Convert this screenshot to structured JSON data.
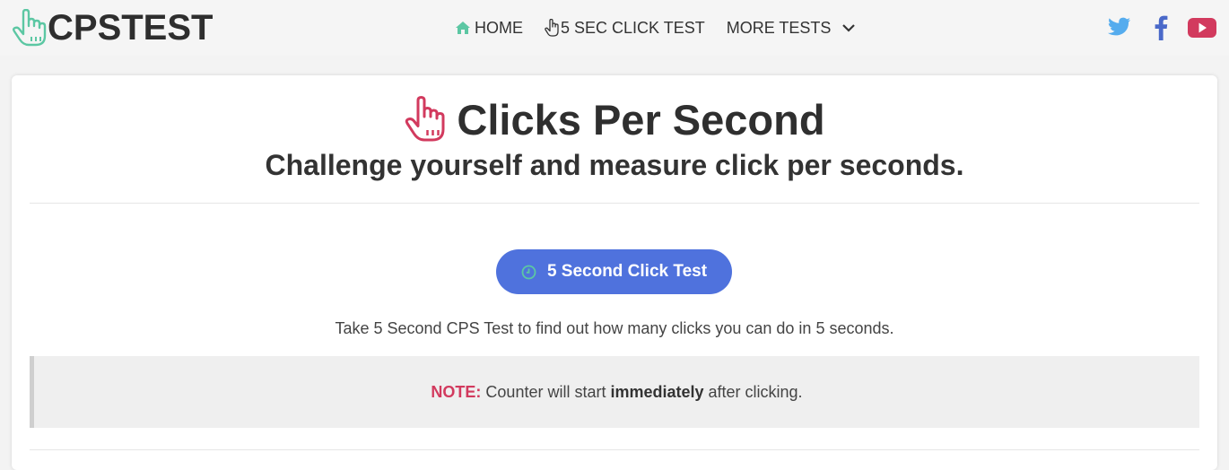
{
  "brand": {
    "name": "CPSTEST"
  },
  "nav": {
    "home": "HOME",
    "five_sec": "5 SEC CLICK TEST",
    "more": "MORE TESTS"
  },
  "social": {
    "twitter_icon": "twitter-icon",
    "facebook_icon": "facebook-icon",
    "youtube_icon": "youtube-icon",
    "colors": {
      "twitter": "#55acee",
      "facebook": "#4a69c9",
      "youtube": "#d23a5e"
    }
  },
  "hero": {
    "title": "Clicks Per Second",
    "subtitle": "Challenge yourself and measure click per seconds."
  },
  "cta": {
    "label": "5 Second Click Test"
  },
  "description": "Take 5 Second CPS Test to find out how many clicks you can do in 5 seconds.",
  "note": {
    "label": "NOTE:",
    "before": "Counter will start",
    "strong": "immediately",
    "after": "after clicking."
  },
  "colors": {
    "accent": "#4f72dd",
    "logo": "#5cc7a3",
    "hand": "#d23a5e",
    "note_label": "#d23a5e"
  }
}
